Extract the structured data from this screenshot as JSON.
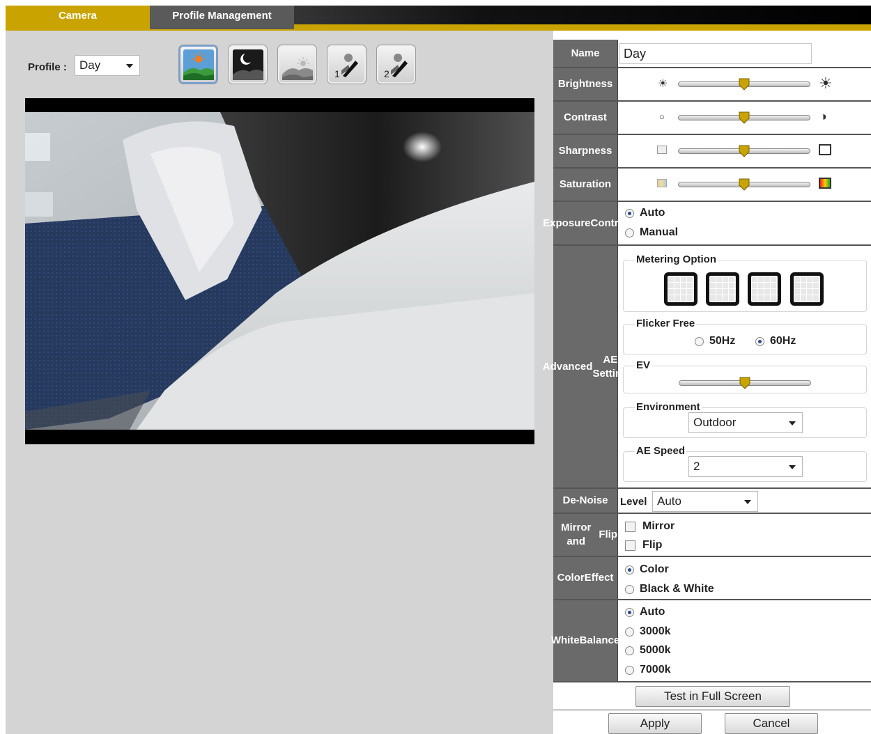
{
  "tabs": {
    "camera": "Camera",
    "profile_management": "Profile Management"
  },
  "profile": {
    "label": "Profile :",
    "selected": "Day"
  },
  "profile_buttons": [
    "day-icon",
    "night-icon",
    "dusk-icon",
    "custom-1-icon",
    "custom-2-icon"
  ],
  "custom_numbers": {
    "one": "1",
    "two": "2"
  },
  "settings": {
    "name_label": "Name",
    "name_value": "Day",
    "brightness_label": "Brightness",
    "brightness_level": 0.5,
    "contrast_label": "Contrast",
    "contrast_level": 0.5,
    "sharpness_label": "Sharpness",
    "sharpness_level": 0.5,
    "saturation_label": "Saturation",
    "saturation_level": 0.5,
    "exposure_label_1": "Exposure",
    "exposure_label_2": "Control",
    "exposure_auto": "Auto",
    "exposure_manual": "Manual",
    "exposure_selected": "Auto",
    "advanced_label_1": "Advanced",
    "advanced_label_2": "AE Setting",
    "metering_legend": "Metering Option",
    "flicker_legend": "Flicker Free",
    "flicker_50": "50Hz",
    "flicker_60": "60Hz",
    "flicker_selected": "60Hz",
    "ev_legend": "EV",
    "ev_level": 0.5,
    "environment_legend": "Environment",
    "environment_value": "Outdoor",
    "ae_speed_legend": "AE Speed",
    "ae_speed_value": "2",
    "denoise_label": "De-Noise",
    "denoise_level_label": "Level",
    "denoise_value": "Auto",
    "mirror_label_1": "Mirror and",
    "mirror_label_2": "Flip",
    "mirror_option": "Mirror",
    "flip_option": "Flip",
    "color_label_1": "Color",
    "color_label_2": "Effect",
    "color_option": "Color",
    "bw_option": "Black & White",
    "wb_label_1": "White",
    "wb_label_2": "Balance",
    "wb_auto": "Auto",
    "wb_3000": "3000k",
    "wb_5000": "5000k",
    "wb_7000": "7000k"
  },
  "buttons": {
    "test_full_screen": "Test in Full Screen",
    "apply": "Apply",
    "cancel": "Cancel"
  },
  "colors": {
    "accent": "#c9a400",
    "label_bg": "#6a6a6a",
    "panel_bg": "#d4d4d4"
  }
}
